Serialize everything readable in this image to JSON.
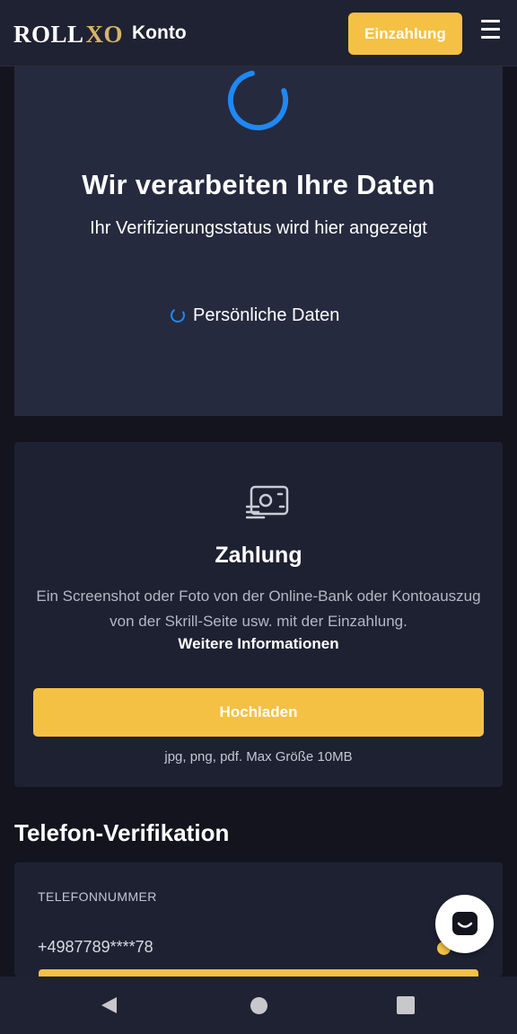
{
  "header": {
    "logo_roll": "ROLL",
    "logo_xo": "XO",
    "title": "Konto",
    "deposit_label": "Einzahlung",
    "menu_icon": "hamburger-menu-icon"
  },
  "processing": {
    "title": "Wir verarbeiten Ihre Daten",
    "subtitle": "Ihr Verifizierungsstatus wird hier angezeigt",
    "status_item": "Persönliche Daten",
    "spinner_color": "#1e88f5"
  },
  "payment": {
    "icon": "payment-screenshot-icon",
    "title": "Zahlung",
    "description": "Ein Screenshot oder Foto von der Online-Bank oder Kontoauszug von der Skrill-Seite usw. mit der Einzahlung.",
    "more_info": "Weitere Informationen",
    "upload_label": "Hochladen",
    "file_hint": "jpg, png, pdf. Max Größe 10MB"
  },
  "phone": {
    "heading": "Telefon-Verifikation",
    "field_label": "TELEFONNUMMER",
    "number": "+4987789****78"
  },
  "colors": {
    "accent": "#f5c144",
    "card": "#252a3e",
    "background": "#14141f"
  },
  "nav": {
    "back": "back-triangle-icon",
    "home": "home-circle-icon",
    "recent": "recent-apps-square-icon"
  }
}
